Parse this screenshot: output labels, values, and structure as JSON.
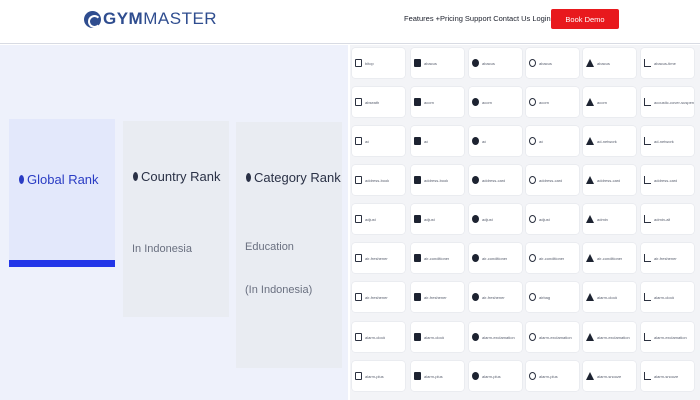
{
  "brand": {
    "name_bold": "GYM",
    "name_light": "MASTER"
  },
  "nav": {
    "items": [
      "Features",
      "+Pricing",
      "Support",
      "Contact Us",
      "Login"
    ],
    "cta": "Book Demo"
  },
  "ranks": {
    "global": {
      "title": "Global Rank"
    },
    "country": {
      "title": "Country Rank",
      "sub": "In Indonesia"
    },
    "category": {
      "title": "Category Rank",
      "sub1": "Education",
      "sub2": "(In Indonesia)"
    }
  },
  "icon_grid": {
    "rows": [
      [
        {
          "label": "bitop",
          "icon": "grip-icon"
        },
        {
          "label": "abacus",
          "icon": "abacus-icon"
        },
        {
          "label": "abacus",
          "icon": "abacus-icon"
        },
        {
          "label": "abacus",
          "icon": "abacus-icon"
        },
        {
          "label": "abacus",
          "icon": "abacus-icon"
        },
        {
          "label": "abacus-time",
          "icon": "abacus-time-icon"
        }
      ],
      [
        {
          "label": "abseath",
          "icon": "climber-icon"
        },
        {
          "label": "acorn",
          "icon": "acorn-icon"
        },
        {
          "label": "acorn",
          "icon": "acorn-icon"
        },
        {
          "label": "acorn",
          "icon": "acorn-icon"
        },
        {
          "label": "acorn",
          "icon": "acorn-icon"
        },
        {
          "label": "acoustic-cover-suspended",
          "icon": "acoustic-icon"
        }
      ],
      [
        {
          "label": "ad",
          "icon": "ad-icon"
        },
        {
          "label": "ad",
          "icon": "ad-icon"
        },
        {
          "label": "ad",
          "icon": "ad-icon"
        },
        {
          "label": "ad",
          "icon": "ad-icon"
        },
        {
          "label": "ad-network",
          "icon": "ad-network-icon"
        },
        {
          "label": "ad-network",
          "icon": "ad-network-icon"
        }
      ],
      [
        {
          "label": "address-book",
          "icon": "address-book-icon"
        },
        {
          "label": "address-book",
          "icon": "address-book-icon"
        },
        {
          "label": "address-card",
          "icon": "address-card-icon"
        },
        {
          "label": "address-card",
          "icon": "address-card-icon"
        },
        {
          "label": "address-card",
          "icon": "address-card-icon"
        },
        {
          "label": "address-card",
          "icon": "address-card-icon"
        }
      ],
      [
        {
          "label": "adjust",
          "icon": "adjust-icon"
        },
        {
          "label": "adjust",
          "icon": "adjust-icon"
        },
        {
          "label": "adjust",
          "icon": "adjust-icon"
        },
        {
          "label": "adjust",
          "icon": "adjust-icon"
        },
        {
          "label": "admin",
          "icon": "admin-icon"
        },
        {
          "label": "admin-alt",
          "icon": "admin-alt-icon"
        }
      ],
      [
        {
          "label": "air-freshener",
          "icon": "air-freshener-icon"
        },
        {
          "label": "air-conditioner",
          "icon": "air-conditioner-icon"
        },
        {
          "label": "air-conditioner",
          "icon": "air-conditioner-icon"
        },
        {
          "label": "air-conditioner",
          "icon": "air-conditioner-icon"
        },
        {
          "label": "air-conditioner",
          "icon": "air-conditioner-icon"
        },
        {
          "label": "air-freshener",
          "icon": "air-freshener-icon"
        }
      ],
      [
        {
          "label": "air-freshener",
          "icon": "air-freshener-icon"
        },
        {
          "label": "air-freshener",
          "icon": "air-freshener-icon"
        },
        {
          "label": "air-freshener",
          "icon": "air-freshener-icon"
        },
        {
          "label": "airbag",
          "icon": "airbag-icon"
        },
        {
          "label": "alarm-clock",
          "icon": "alarm-clock-icon"
        },
        {
          "label": "alarm-clock",
          "icon": "alarm-clock-icon"
        }
      ],
      [
        {
          "label": "alarm-clock",
          "icon": "alarm-clock-icon"
        },
        {
          "label": "alarm-clock",
          "icon": "alarm-clock-icon"
        },
        {
          "label": "alarm-exclamation",
          "icon": "alarm-exclamation-icon"
        },
        {
          "label": "alarm-exclamation",
          "icon": "alarm-exclamation-icon"
        },
        {
          "label": "alarm-exclamation",
          "icon": "alarm-exclamation-icon"
        },
        {
          "label": "alarm-exclamation",
          "icon": "alarm-exclamation-icon"
        }
      ],
      [
        {
          "label": "alarm-plus",
          "icon": "alarm-plus-icon"
        },
        {
          "label": "alarm-plus",
          "icon": "alarm-plus-icon"
        },
        {
          "label": "alarm-plus",
          "icon": "alarm-plus-icon"
        },
        {
          "label": "alarm-plus",
          "icon": "alarm-plus-icon"
        },
        {
          "label": "alarm-snooze",
          "icon": "alarm-snooze-icon"
        },
        {
          "label": "alarm-snooze",
          "icon": "alarm-snooze-icon"
        }
      ]
    ]
  }
}
